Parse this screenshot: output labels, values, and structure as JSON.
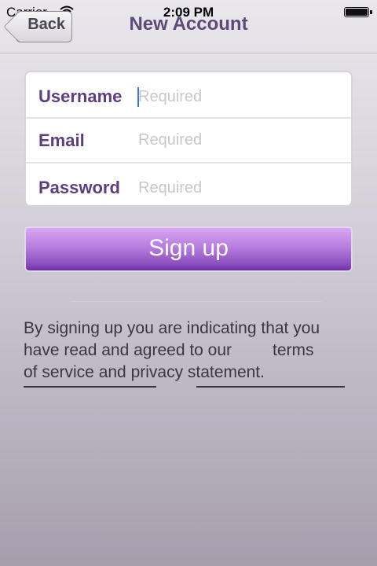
{
  "status_bar": {
    "carrier": "Carrier",
    "time": "2:09 PM",
    "wifi_icon": "wifi-icon",
    "battery_icon": "battery-full-icon"
  },
  "nav": {
    "back_label": "Back",
    "title": "New Account"
  },
  "form": {
    "fields": [
      {
        "label": "Username",
        "placeholder": "Required",
        "value": ""
      },
      {
        "label": "Email",
        "placeholder": "Required",
        "value": ""
      },
      {
        "label": "Password",
        "placeholder": "Required",
        "value": ""
      }
    ]
  },
  "signup_button": {
    "label": "Sign up"
  },
  "terms": {
    "line1": "By signing up you are indicating that you",
    "line2_a": "have read and agreed to our",
    "line2_b": "terms",
    "line3": "of service and privacy statement."
  },
  "colors": {
    "accent": "#5e3d80",
    "button_top": "#d8a6f1",
    "button_bottom": "#6d2ea1"
  }
}
